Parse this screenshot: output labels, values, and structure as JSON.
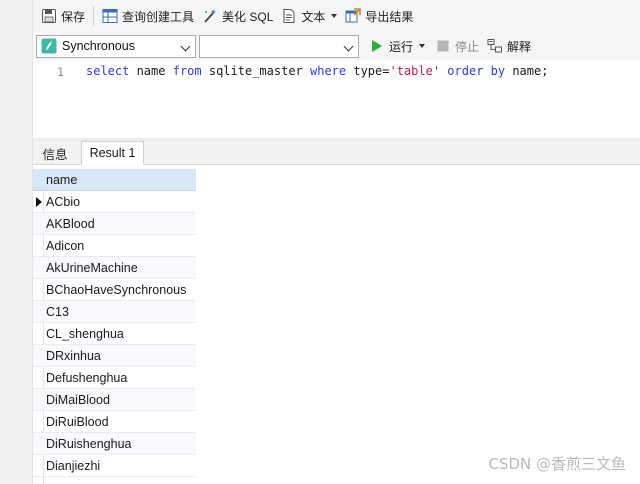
{
  "toolbar": {
    "save_label": "保存",
    "query_builder_label": "查询创建工具",
    "beautify_sql_label": "美化 SQL",
    "text_label": "文本",
    "export_label": "导出结果"
  },
  "run_bar": {
    "connection_value": "Synchronous",
    "database_value": "",
    "run_label": "运行",
    "stop_label": "停止",
    "explain_label": "解释"
  },
  "editor": {
    "line_number": "1",
    "tokens": [
      "select",
      " name ",
      "from",
      " sqlite_master ",
      "where",
      " type=",
      "'table'",
      " ",
      "order by",
      " name;"
    ]
  },
  "tabs": {
    "info": "信息",
    "result": "Result 1"
  },
  "grid": {
    "column": "name",
    "rows": [
      "ACbio",
      "AKBlood",
      "Adicon",
      "AkUrineMachine",
      "BChaoHaveSynchronous",
      "C13",
      "CL_shenghua",
      "DRxinhua",
      "Defushenghua",
      "DiMaiBlood",
      "DiRuiBlood",
      "DiRuishenghua",
      "Dianjiezhi"
    ]
  },
  "watermark": "CSDN @香煎三文鱼",
  "colors": {
    "keyword": "#2b3de1",
    "string": "#c2185b",
    "header_bg": "#d7e7f8"
  }
}
